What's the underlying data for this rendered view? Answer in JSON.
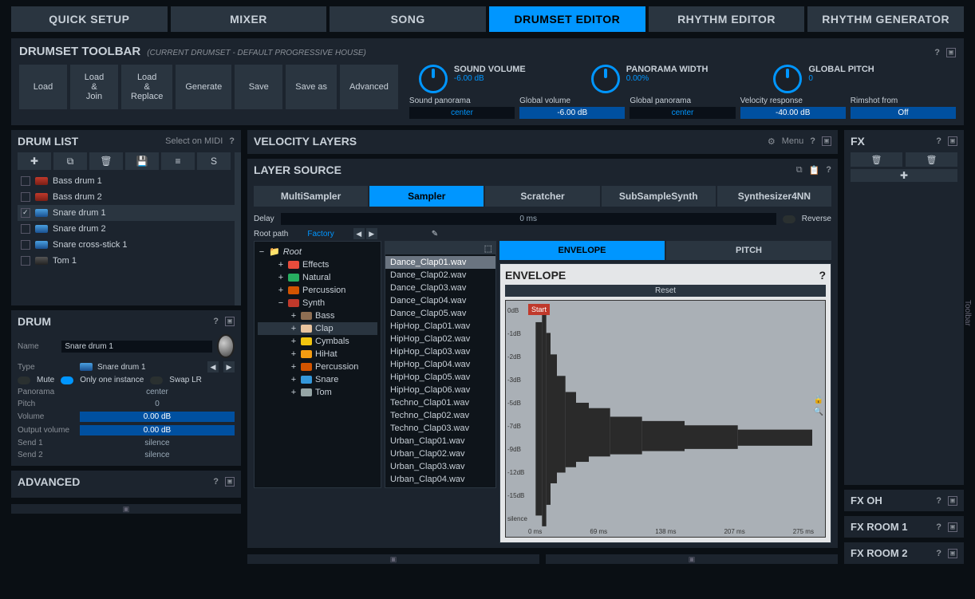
{
  "mainTabs": [
    "QUICK SETUP",
    "MIXER",
    "SONG",
    "DRUMSET EDITOR",
    "RHYTHM EDITOR",
    "RHYTHM GENERATOR"
  ],
  "activeMainTab": 3,
  "toolbar": {
    "title": "DRUMSET TOOLBAR",
    "subtitle": "(CURRENT DRUMSET - DEFAULT PROGRESSIVE HOUSE)",
    "buttons": [
      "Load",
      "Load\n&\nJoin",
      "Load\n&\nReplace",
      "Generate",
      "Save",
      "Save as",
      "Advanced"
    ],
    "knobs": [
      {
        "label": "SOUND VOLUME",
        "value": "-6.00 dB"
      },
      {
        "label": "PANORAMA WIDTH",
        "value": "0.00%"
      },
      {
        "label": "GLOBAL PITCH",
        "value": "0"
      }
    ],
    "params": [
      {
        "label": "Sound panorama",
        "value": "center"
      },
      {
        "label": "Global volume",
        "value": "-6.00 dB"
      },
      {
        "label": "Global panorama",
        "value": "center"
      },
      {
        "label": "Velocity response",
        "value": "-40.00 dB"
      },
      {
        "label": "Rimshot from",
        "value": "Off"
      }
    ]
  },
  "drumList": {
    "title": "DRUM LIST",
    "selectOnMidi": "Select on MIDI",
    "items": [
      {
        "name": "Bass drum 1",
        "type": "bass",
        "checked": false
      },
      {
        "name": "Bass drum 2",
        "type": "bass",
        "checked": false
      },
      {
        "name": "Snare drum 1",
        "type": "snare",
        "checked": true,
        "selected": true
      },
      {
        "name": "Snare drum 2",
        "type": "snare",
        "checked": false
      },
      {
        "name": "Snare cross-stick 1",
        "type": "snare",
        "checked": false
      },
      {
        "name": "Tom 1",
        "type": "tom",
        "checked": false
      }
    ]
  },
  "drum": {
    "title": "DRUM",
    "name_label": "Name",
    "name": "Snare drum 1",
    "type_label": "Type",
    "type": "Snare drum 1",
    "mute": "Mute",
    "onlyOne": "Only one instance",
    "swap": "Swap LR",
    "rows": [
      {
        "label": "Panorama",
        "value": "center",
        "style": "center"
      },
      {
        "label": "Pitch",
        "value": "0",
        "style": "center"
      },
      {
        "label": "Volume",
        "value": "0.00 dB",
        "style": "blue"
      },
      {
        "label": "Output volume",
        "value": "0.00 dB",
        "style": "blue"
      },
      {
        "label": "Send 1",
        "value": "silence",
        "style": "center"
      },
      {
        "label": "Send 2",
        "value": "silence",
        "style": "center"
      }
    ]
  },
  "advanced": {
    "title": "ADVANCED"
  },
  "velocityLayers": {
    "title": "VELOCITY LAYERS",
    "menu": "Menu"
  },
  "layerSource": {
    "title": "LAYER SOURCE",
    "tabs": [
      "MultiSampler",
      "Sampler",
      "Scratcher",
      "SubSampleSynth",
      "Synthesizer4NN"
    ],
    "activeTab": 1,
    "delay_label": "Delay",
    "delay": "0 ms",
    "reverse": "Reverse",
    "rootPath_label": "Root path",
    "rootPath": "Factory",
    "tree": {
      "root": "Root",
      "folders": [
        "Effects",
        "Natural",
        "Percussion",
        "Synth"
      ],
      "synthChildren": [
        "Bass",
        "Clap",
        "Cymbals",
        "HiHat",
        "Percussion",
        "Snare",
        "Tom"
      ],
      "selectedChild": 1
    },
    "files": [
      "Dance_Clap01.wav",
      "Dance_Clap02.wav",
      "Dance_Clap03.wav",
      "Dance_Clap04.wav",
      "Dance_Clap05.wav",
      "HipHop_Clap01.wav",
      "HipHop_Clap02.wav",
      "HipHop_Clap03.wav",
      "HipHop_Clap04.wav",
      "HipHop_Clap05.wav",
      "HipHop_Clap06.wav",
      "Techno_Clap01.wav",
      "Techno_Clap02.wav",
      "Techno_Clap03.wav",
      "Urban_Clap01.wav",
      "Urban_Clap02.wav",
      "Urban_Clap03.wav",
      "Urban_Clap04.wav"
    ],
    "selectedFile": 0
  },
  "envelope": {
    "tabs": [
      "ENVELOPE",
      "PITCH"
    ],
    "activeTab": 0,
    "title": "ENVELOPE",
    "reset": "Reset",
    "start": "Start",
    "yLabels": [
      "0dB",
      "-1dB",
      "-2dB",
      "-3dB",
      "-5dB",
      "-7dB",
      "-9dB",
      "-12dB",
      "-15dB",
      "silence"
    ],
    "xLabels": [
      "0 ms",
      "69 ms",
      "138 ms",
      "207 ms",
      "275 ms"
    ]
  },
  "fx": {
    "title": "FX",
    "oh": "FX OH",
    "room1": "FX ROOM 1",
    "room2": "FX ROOM 2"
  },
  "sideToolbar": "Toolbar"
}
